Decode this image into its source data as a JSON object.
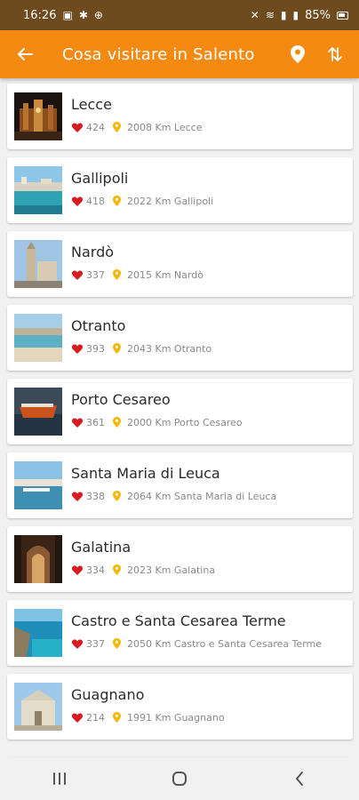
{
  "status_bar": {
    "time": "16:26",
    "battery": "85%"
  },
  "app_bar": {
    "title": "Cosa visitare in Salento"
  },
  "colors": {
    "accent": "#f58a12",
    "status_bar": "#6e4a1f",
    "heart": "#d81b21",
    "pin": "#f5b700"
  },
  "places": [
    {
      "name": "Lecce",
      "likes": "424",
      "distance": "2008 Km Lecce",
      "image": "night-city"
    },
    {
      "name": "Gallipoli",
      "likes": "418",
      "distance": "2022 Km Gallipoli",
      "image": "coast"
    },
    {
      "name": "Nardò",
      "likes": "337",
      "distance": "2015 Km Nardò",
      "image": "tower"
    },
    {
      "name": "Otranto",
      "likes": "393",
      "distance": "2043 Km Otranto",
      "image": "beach"
    },
    {
      "name": "Porto Cesareo",
      "likes": "361",
      "distance": "2000 Km Porto Cesareo",
      "image": "boat"
    },
    {
      "name": "Santa Maria di Leuca",
      "likes": "338",
      "distance": "2064 Km Santa Maria di Leuca",
      "image": "harbor"
    },
    {
      "name": "Galatina",
      "likes": "334",
      "distance": "2023 Km Galatina",
      "image": "church-interior"
    },
    {
      "name": "Castro e Santa Cesarea Terme",
      "likes": "337",
      "distance": "2050 Km Castro e Santa Cesarea Terme",
      "image": "sea-cliff"
    },
    {
      "name": "Guagnano",
      "likes": "214",
      "distance": "1991 Km Guagnano",
      "image": "church-facade"
    }
  ]
}
